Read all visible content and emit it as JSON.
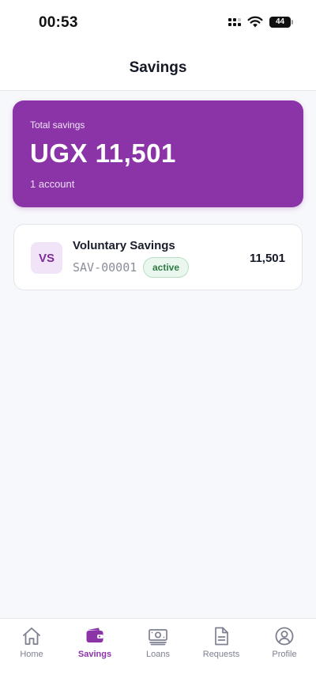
{
  "status_bar": {
    "time": "00:53",
    "battery": "44"
  },
  "header": {
    "title": "Savings"
  },
  "summary": {
    "label": "Total savings",
    "amount": "UGX 11,501",
    "count": "1 account"
  },
  "accounts": [
    {
      "initials": "VS",
      "name": "Voluntary Savings",
      "number": "SAV-00001",
      "status": "active",
      "balance": "11,501"
    }
  ],
  "nav": {
    "active": "Savings",
    "items": [
      {
        "label": "Home",
        "icon": "home-icon"
      },
      {
        "label": "Savings",
        "icon": "wallet-icon"
      },
      {
        "label": "Loans",
        "icon": "cash-icon"
      },
      {
        "label": "Requests",
        "icon": "document-icon"
      },
      {
        "label": "Profile",
        "icon": "user-circle-icon"
      }
    ]
  },
  "colors": {
    "brand": "#8a34a8",
    "active_badge_bg": "#e9f7ee",
    "active_badge_text": "#2f7a45",
    "nav_inactive": "#7d8191"
  }
}
